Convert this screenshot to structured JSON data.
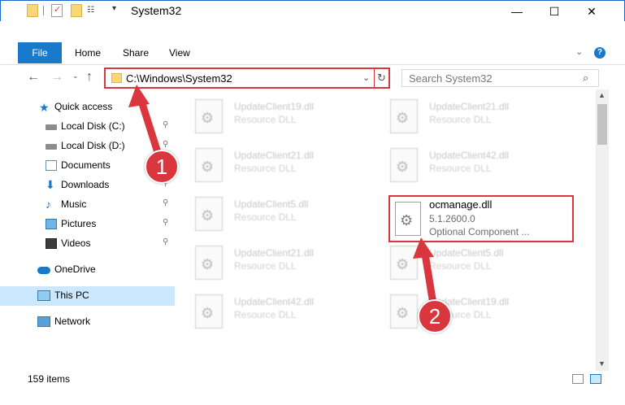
{
  "window": {
    "title": "System32",
    "controls": {
      "minimize": "—",
      "maximize": "☐",
      "close": "✕"
    }
  },
  "quick_access_toolbar": {
    "dropdown": "▾"
  },
  "ribbon": {
    "tabs": [
      "File",
      "Home",
      "Share",
      "View"
    ],
    "expand_icon": "⌄",
    "help": "?"
  },
  "address_bar": {
    "path": "C:\\Windows\\System32",
    "dropdown": "⌄",
    "refresh": "↻"
  },
  "search": {
    "placeholder": "Search System32",
    "icon": "⌕"
  },
  "nav_buttons": {
    "back": "←",
    "forward": "→",
    "recent": "⌄",
    "up": "↑"
  },
  "navigation_pane": {
    "items": [
      {
        "label": "Quick access",
        "icon": "star-icon",
        "pinned": false
      },
      {
        "label": "Local Disk (C:)",
        "icon": "drive-icon",
        "pinned": true
      },
      {
        "label": "Local Disk (D:)",
        "icon": "drive-icon",
        "pinned": true
      },
      {
        "label": "Documents",
        "icon": "documents-icon",
        "pinned": true
      },
      {
        "label": "Downloads",
        "icon": "downloads-icon",
        "pinned": true
      },
      {
        "label": "Music",
        "icon": "music-icon",
        "pinned": true
      },
      {
        "label": "Pictures",
        "icon": "pictures-icon",
        "pinned": true
      },
      {
        "label": "Videos",
        "icon": "videos-icon",
        "pinned": true
      },
      {
        "label": "OneDrive",
        "icon": "cloud-icon",
        "pinned": false
      },
      {
        "label": "This PC",
        "icon": "computer-icon",
        "pinned": false,
        "selected": true
      },
      {
        "label": "Network",
        "icon": "network-icon",
        "pinned": false
      }
    ],
    "pin_glyph": "📌"
  },
  "files": [
    {
      "name": "UpdateClient19.dll",
      "type": "Resource DLL"
    },
    {
      "name": "UpdateClient21.dll",
      "type": "Resource DLL"
    },
    {
      "name": "UpdateClient21.dll",
      "type": "Resource DLL"
    },
    {
      "name": "UpdateClient42.dll",
      "type": "Resource DLL"
    },
    {
      "name": "UpdateClient5.dll",
      "type": "Resource DLL"
    },
    {
      "name": "UpdateClient21.dll",
      "type": "Resource DLL"
    },
    {
      "name": "UpdateClient5.dll",
      "type": "Resource DLL"
    },
    {
      "name": "UpdateClient42.dll",
      "type": "Resource DLL"
    },
    {
      "name": "UpdateClient19.dll",
      "type": "Resource DLL"
    }
  ],
  "highlighted_file": {
    "name": "ocmanage.dll",
    "version": "5.1.2600.0",
    "description": "Optional Component ..."
  },
  "status_bar": {
    "item_count": "159 items"
  },
  "annotations": {
    "step1": "1",
    "step2": "2",
    "color": "#d9363e"
  }
}
